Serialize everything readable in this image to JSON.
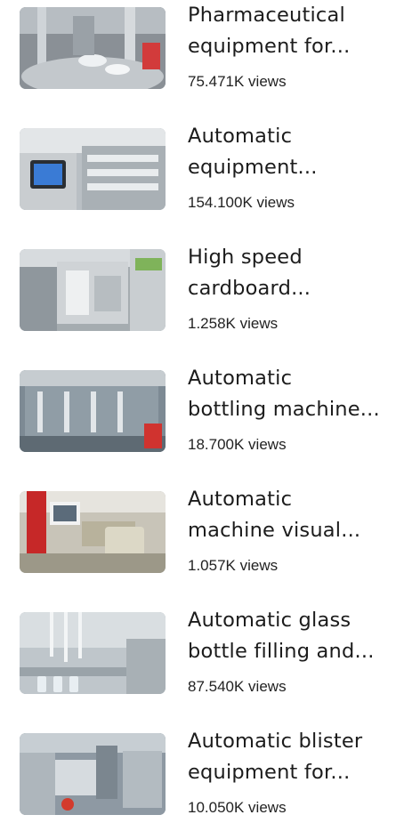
{
  "videos": [
    {
      "title_line1": "Pharmaceutical",
      "title_line2": "equipment for...",
      "views": "75.471K views",
      "thumb_icon": "pharmaceutical-machine-thumbnail",
      "colors": {
        "bg": "#8a9096",
        "accent": "#d23b3b"
      }
    },
    {
      "title_line1": "Automatic",
      "title_line2": "equipment...",
      "views": "154.100K views",
      "thumb_icon": "control-panel-thumbnail",
      "colors": {
        "bg": "#b9bfc4",
        "accent": "#3a7bd5"
      }
    },
    {
      "title_line1": "High speed",
      "title_line2": "cardboard...",
      "views": "1.258K views",
      "thumb_icon": "cardboard-machine-thumbnail",
      "colors": {
        "bg": "#a5acb0",
        "accent": "#7fb35a"
      }
    },
    {
      "title_line1": "Automatic",
      "title_line2": "bottling machine...",
      "views": "18.700K views",
      "thumb_icon": "bottling-line-thumbnail",
      "colors": {
        "bg": "#7d8a94",
        "accent": "#d0332f"
      }
    },
    {
      "title_line1": "Automatic",
      "title_line2": "machine visual...",
      "views": "1.057K views",
      "thumb_icon": "visual-inspection-thumbnail",
      "colors": {
        "bg": "#c8c4b8",
        "accent": "#c62828"
      }
    },
    {
      "title_line1": "Automatic glass",
      "title_line2": "bottle filling and...",
      "views": "87.540K views",
      "thumb_icon": "filling-nozzles-thumbnail",
      "colors": {
        "bg": "#bfc6cb",
        "accent": "#e8eef2"
      }
    },
    {
      "title_line1": "Automatic blister",
      "title_line2": "equipment for...",
      "views": "10.050K views",
      "thumb_icon": "blister-machine-thumbnail",
      "colors": {
        "bg": "#8e99a3",
        "accent": "#d33a2c"
      }
    }
  ]
}
